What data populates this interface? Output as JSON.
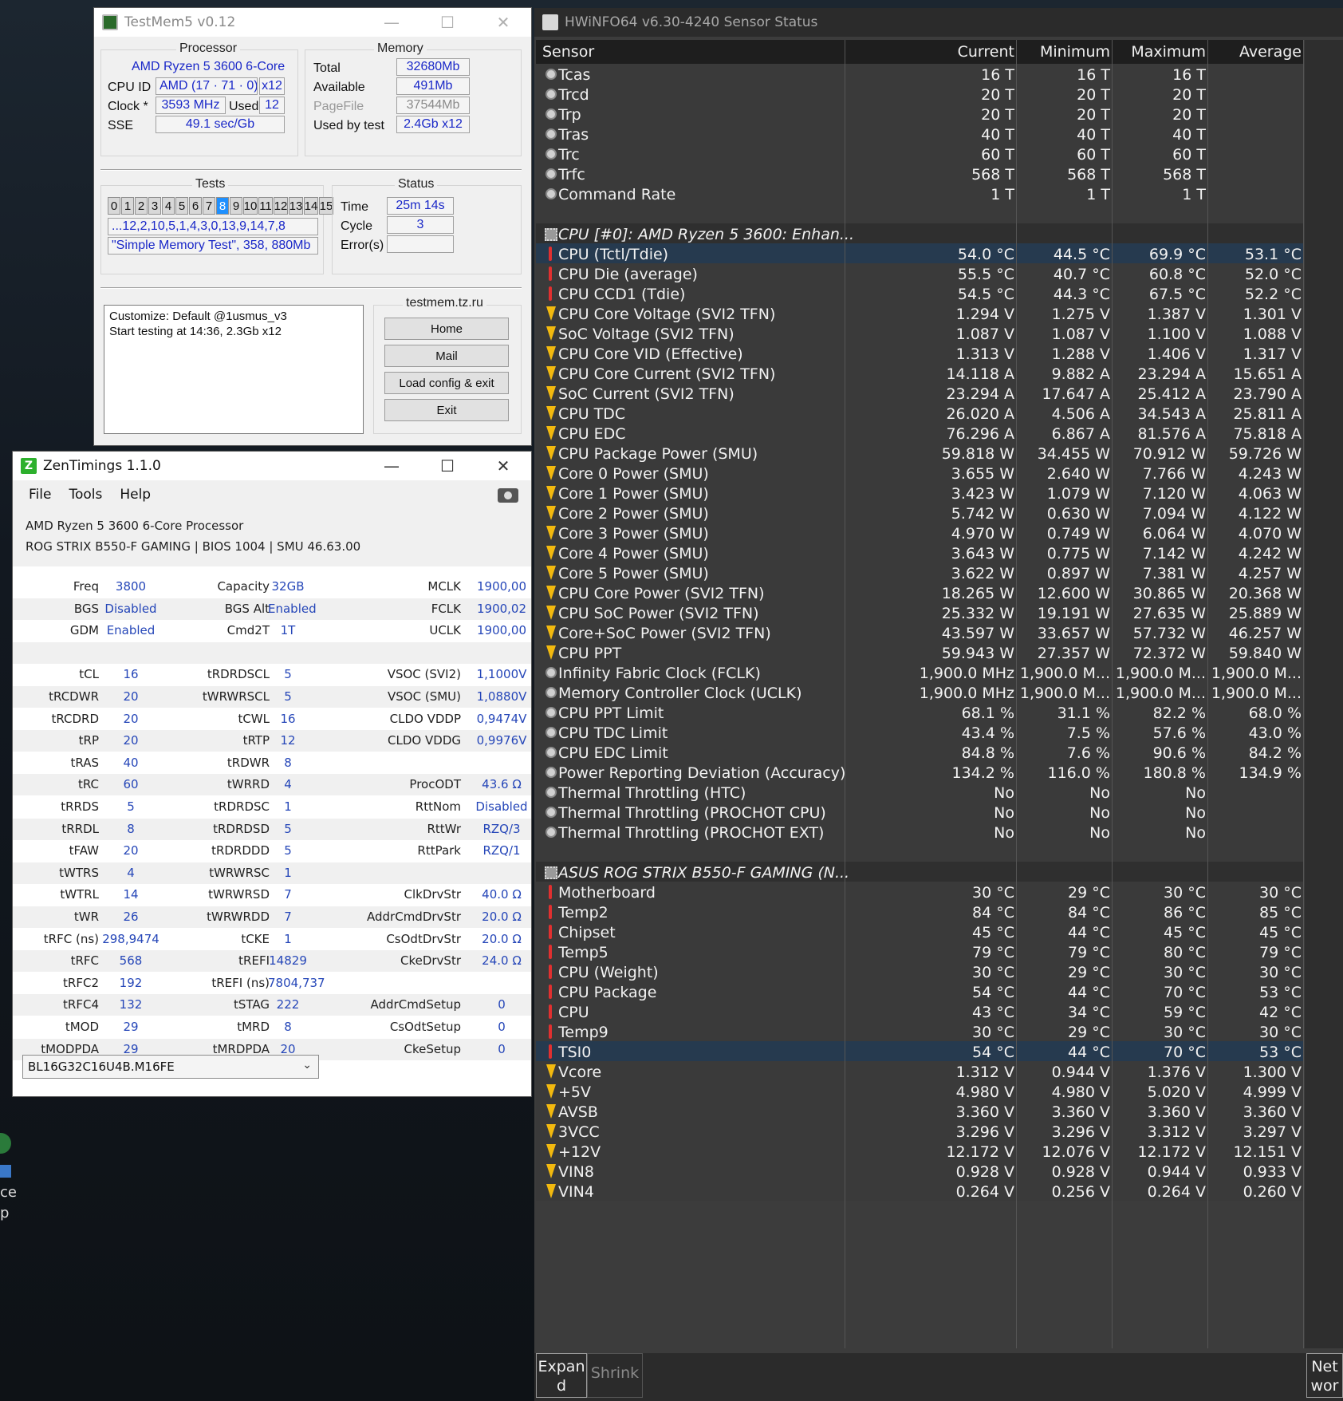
{
  "testmem": {
    "title": "TestMem5 v0.12",
    "processor_legend": "Processor",
    "cpu_name": "AMD Ryzen 5 3600 6-Core",
    "cpu_id_label": "CPU ID",
    "cpu_id_value": "AMD  (17 · 71 · 0)",
    "cpu_id_threads": "x12",
    "clock_label": "Clock *",
    "clock_value": "3593 MHz",
    "used_label": "Used",
    "used_value": "12",
    "sse_label": "SSE",
    "sse_value": "49.1 sec/Gb",
    "memory_legend": "Memory",
    "total_label": "Total",
    "total_value": "32680Mb",
    "available_label": "Available",
    "available_value": "491Mb",
    "pagefile_label": "PageFile",
    "pagefile_value": "37544Mb",
    "usedbytest_label": "Used by test",
    "usedbytest_value": "2.4Gb x12",
    "tests_legend": "Tests",
    "test_numbers": [
      "0",
      "1",
      "2",
      "3",
      "4",
      "5",
      "6",
      "7",
      "8",
      "9",
      "10",
      "11",
      "12",
      "13",
      "14",
      "15"
    ],
    "active_test": "8",
    "test_order": "...12,2,10,5,1,4,3,0,13,9,14,7,8",
    "test_desc": "\"Simple Memory Test\", 358, 880Mb",
    "status_legend": "Status",
    "time_label": "Time",
    "time_value": "25m 14s",
    "cycle_label": "Cycle",
    "cycle_value": "3",
    "errors_label": "Error(s)",
    "errors_value": "",
    "site_label": "testmem.tz.ru",
    "log_line1": "Customize: Default @1usmus_v3",
    "log_line2": "Start testing at 14:36, 2.3Gb x12",
    "btn_home": "Home",
    "btn_mail": "Mail",
    "btn_load": "Load config & exit",
    "btn_exit": "Exit"
  },
  "zen": {
    "title": "ZenTimings 1.1.0",
    "menu": [
      "File",
      "Tools",
      "Help"
    ],
    "cpu": "AMD Ryzen 5 3600 6-Core Processor",
    "board": "ROG STRIX B550-F GAMING | BIOS 1004 | SMU 46.63.00",
    "rows": [
      [
        [
          "Freq",
          "3800"
        ],
        [
          "Capacity",
          "32GB"
        ],
        [
          "MCLK",
          "1900,00"
        ]
      ],
      [
        [
          "BGS",
          "Disabled"
        ],
        [
          "BGS Alt",
          "Enabled"
        ],
        [
          "FCLK",
          "1900,02"
        ]
      ],
      [
        [
          "GDM",
          "Enabled"
        ],
        [
          "Cmd2T",
          "1T"
        ],
        [
          "UCLK",
          "1900,00"
        ]
      ],
      [
        [
          "",
          ""
        ],
        [
          "",
          ""
        ],
        [
          "",
          ""
        ]
      ],
      [
        [
          "tCL",
          "16"
        ],
        [
          "tRDRDSCL",
          "5"
        ],
        [
          "VSOC (SVI2)",
          "1,1000V"
        ]
      ],
      [
        [
          "tRCDWR",
          "20"
        ],
        [
          "tWRWRSCL",
          "5"
        ],
        [
          "VSOC (SMU)",
          "1,0880V"
        ]
      ],
      [
        [
          "tRCDRD",
          "20"
        ],
        [
          "tCWL",
          "16"
        ],
        [
          "CLDO VDDP",
          "0,9474V"
        ]
      ],
      [
        [
          "tRP",
          "20"
        ],
        [
          "tRTP",
          "12"
        ],
        [
          "CLDO VDDG",
          "0,9976V"
        ]
      ],
      [
        [
          "tRAS",
          "40"
        ],
        [
          "tRDWR",
          "8"
        ],
        [
          "",
          ""
        ]
      ],
      [
        [
          "tRC",
          "60"
        ],
        [
          "tWRRD",
          "4"
        ],
        [
          "ProcODT",
          "43.6 Ω"
        ]
      ],
      [
        [
          "tRRDS",
          "5"
        ],
        [
          "tRDRDSC",
          "1"
        ],
        [
          "RttNom",
          "Disabled"
        ]
      ],
      [
        [
          "tRRDL",
          "8"
        ],
        [
          "tRDRDSD",
          "5"
        ],
        [
          "RttWr",
          "RZQ/3"
        ]
      ],
      [
        [
          "tFAW",
          "20"
        ],
        [
          "tRDRDDD",
          "5"
        ],
        [
          "RttPark",
          "RZQ/1"
        ]
      ],
      [
        [
          "tWTRS",
          "4"
        ],
        [
          "tWRWRSC",
          "1"
        ],
        [
          "",
          ""
        ]
      ],
      [
        [
          "tWTRL",
          "14"
        ],
        [
          "tWRWRSD",
          "7"
        ],
        [
          "ClkDrvStr",
          "40.0 Ω"
        ]
      ],
      [
        [
          "tWR",
          "26"
        ],
        [
          "tWRWRDD",
          "7"
        ],
        [
          "AddrCmdDrvStr",
          "20.0 Ω"
        ]
      ],
      [
        [
          "tRFC (ns)",
          "298,9474"
        ],
        [
          "tCKE",
          "1"
        ],
        [
          "CsOdtDrvStr",
          "20.0 Ω"
        ]
      ],
      [
        [
          "tRFC",
          "568"
        ],
        [
          "tREFI",
          "14829"
        ],
        [
          "CkeDrvStr",
          "24.0 Ω"
        ]
      ],
      [
        [
          "tRFC2",
          "192"
        ],
        [
          "tREFI (ns)",
          "7804,737"
        ],
        [
          "",
          ""
        ]
      ],
      [
        [
          "tRFC4",
          "132"
        ],
        [
          "tSTAG",
          "222"
        ],
        [
          "AddrCmdSetup",
          "0"
        ]
      ],
      [
        [
          "tMOD",
          "29"
        ],
        [
          "tMRD",
          "8"
        ],
        [
          "CsOdtSetup",
          "0"
        ]
      ],
      [
        [
          "tMODPDA",
          "29"
        ],
        [
          "tMRDPDA",
          "20"
        ],
        [
          "CkeSetup",
          "0"
        ]
      ]
    ],
    "module": "BL16G32C16U4B.M16FE"
  },
  "hw": {
    "title": "HWiNFO64 v6.30-4240 Sensor Status",
    "headers": [
      "Sensor",
      "Current",
      "Minimum",
      "Maximum",
      "Average"
    ],
    "rows": [
      {
        "t": "clock",
        "n": "Tcas",
        "c": "16 T",
        "mi": "16 T",
        "ma": "16 T",
        "a": ""
      },
      {
        "t": "clock",
        "n": "Trcd",
        "c": "20 T",
        "mi": "20 T",
        "ma": "20 T",
        "a": ""
      },
      {
        "t": "clock",
        "n": "Trp",
        "c": "20 T",
        "mi": "20 T",
        "ma": "20 T",
        "a": ""
      },
      {
        "t": "clock",
        "n": "Tras",
        "c": "40 T",
        "mi": "40 T",
        "ma": "40 T",
        "a": ""
      },
      {
        "t": "clock",
        "n": "Trc",
        "c": "60 T",
        "mi": "60 T",
        "ma": "60 T",
        "a": ""
      },
      {
        "t": "clock",
        "n": "Trfc",
        "c": "568 T",
        "mi": "568 T",
        "ma": "568 T",
        "a": ""
      },
      {
        "t": "clock",
        "n": "Command Rate",
        "c": "1 T",
        "mi": "1 T",
        "ma": "1 T",
        "a": ""
      },
      {
        "t": "blank",
        "n": "",
        "c": "",
        "mi": "",
        "ma": "",
        "a": ""
      },
      {
        "t": "group",
        "n": "CPU [#0]: AMD Ryzen 5 3600: Enhan...",
        "c": "",
        "mi": "",
        "ma": "",
        "a": ""
      },
      {
        "t": "therm",
        "n": "CPU (Tctl/Tdie)",
        "c": "54.0 °C",
        "mi": "44.5 °C",
        "ma": "69.9 °C",
        "a": "53.1 °C",
        "sel": true
      },
      {
        "t": "therm",
        "n": "CPU Die (average)",
        "c": "55.5 °C",
        "mi": "40.7 °C",
        "ma": "60.8 °C",
        "a": "52.0 °C"
      },
      {
        "t": "therm",
        "n": "CPU CCD1 (Tdie)",
        "c": "54.5 °C",
        "mi": "44.3 °C",
        "ma": "67.5 °C",
        "a": "52.2 °C"
      },
      {
        "t": "bolt",
        "n": "CPU Core Voltage (SVI2 TFN)",
        "c": "1.294 V",
        "mi": "1.275 V",
        "ma": "1.387 V",
        "a": "1.301 V"
      },
      {
        "t": "bolt",
        "n": "SoC Voltage (SVI2 TFN)",
        "c": "1.087 V",
        "mi": "1.087 V",
        "ma": "1.100 V",
        "a": "1.088 V"
      },
      {
        "t": "bolt",
        "n": "CPU Core VID (Effective)",
        "c": "1.313 V",
        "mi": "1.288 V",
        "ma": "1.406 V",
        "a": "1.317 V"
      },
      {
        "t": "bolt",
        "n": "CPU Core Current (SVI2 TFN)",
        "c": "14.118 A",
        "mi": "9.882 A",
        "ma": "23.294 A",
        "a": "15.651 A"
      },
      {
        "t": "bolt",
        "n": "SoC Current (SVI2 TFN)",
        "c": "23.294 A",
        "mi": "17.647 A",
        "ma": "25.412 A",
        "a": "23.790 A"
      },
      {
        "t": "bolt",
        "n": "CPU TDC",
        "c": "26.020 A",
        "mi": "4.506 A",
        "ma": "34.543 A",
        "a": "25.811 A"
      },
      {
        "t": "bolt",
        "n": "CPU EDC",
        "c": "76.296 A",
        "mi": "6.867 A",
        "ma": "81.576 A",
        "a": "75.818 A"
      },
      {
        "t": "bolt",
        "n": "CPU Package Power (SMU)",
        "c": "59.818 W",
        "mi": "34.455 W",
        "ma": "70.912 W",
        "a": "59.726 W"
      },
      {
        "t": "bolt",
        "n": "Core 0 Power (SMU)",
        "c": "3.655 W",
        "mi": "2.640 W",
        "ma": "7.766 W",
        "a": "4.243 W"
      },
      {
        "t": "bolt",
        "n": "Core 1 Power (SMU)",
        "c": "3.423 W",
        "mi": "1.079 W",
        "ma": "7.120 W",
        "a": "4.063 W"
      },
      {
        "t": "bolt",
        "n": "Core 2 Power (SMU)",
        "c": "5.742 W",
        "mi": "0.630 W",
        "ma": "7.094 W",
        "a": "4.122 W"
      },
      {
        "t": "bolt",
        "n": "Core 3 Power (SMU)",
        "c": "4.970 W",
        "mi": "0.749 W",
        "ma": "6.064 W",
        "a": "4.070 W"
      },
      {
        "t": "bolt",
        "n": "Core 4 Power (SMU)",
        "c": "3.643 W",
        "mi": "0.775 W",
        "ma": "7.142 W",
        "a": "4.242 W"
      },
      {
        "t": "bolt",
        "n": "Core 5 Power (SMU)",
        "c": "3.622 W",
        "mi": "0.897 W",
        "ma": "7.381 W",
        "a": "4.257 W"
      },
      {
        "t": "bolt",
        "n": "CPU Core Power (SVI2 TFN)",
        "c": "18.265 W",
        "mi": "12.600 W",
        "ma": "30.865 W",
        "a": "20.368 W"
      },
      {
        "t": "bolt",
        "n": "CPU SoC Power (SVI2 TFN)",
        "c": "25.332 W",
        "mi": "19.191 W",
        "ma": "27.635 W",
        "a": "25.889 W"
      },
      {
        "t": "bolt",
        "n": "Core+SoC Power (SVI2 TFN)",
        "c": "43.597 W",
        "mi": "33.657 W",
        "ma": "57.732 W",
        "a": "46.257 W"
      },
      {
        "t": "bolt",
        "n": "CPU PPT",
        "c": "59.943 W",
        "mi": "27.357 W",
        "ma": "72.372 W",
        "a": "59.840 W"
      },
      {
        "t": "clock",
        "n": "Infinity Fabric Clock (FCLK)",
        "c": "1,900.0 MHz",
        "mi": "1,900.0 M...",
        "ma": "1,900.0 M...",
        "a": "1,900.0 M..."
      },
      {
        "t": "clock",
        "n": "Memory Controller Clock (UCLK)",
        "c": "1,900.0 MHz",
        "mi": "1,900.0 M...",
        "ma": "1,900.0 M...",
        "a": "1,900.0 M..."
      },
      {
        "t": "clock",
        "n": "CPU PPT Limit",
        "c": "68.1 %",
        "mi": "31.1 %",
        "ma": "82.2 %",
        "a": "68.0 %"
      },
      {
        "t": "clock",
        "n": "CPU TDC Limit",
        "c": "43.4 %",
        "mi": "7.5 %",
        "ma": "57.6 %",
        "a": "43.0 %"
      },
      {
        "t": "clock",
        "n": "CPU EDC Limit",
        "c": "84.8 %",
        "mi": "7.6 %",
        "ma": "90.6 %",
        "a": "84.2 %"
      },
      {
        "t": "clock",
        "n": "Power Reporting Deviation (Accuracy)",
        "c": "134.2 %",
        "mi": "116.0 %",
        "ma": "180.8 %",
        "a": "134.9 %"
      },
      {
        "t": "clock",
        "n": "Thermal Throttling (HTC)",
        "c": "No",
        "mi": "No",
        "ma": "No",
        "a": ""
      },
      {
        "t": "clock",
        "n": "Thermal Throttling (PROCHOT CPU)",
        "c": "No",
        "mi": "No",
        "ma": "No",
        "a": ""
      },
      {
        "t": "clock",
        "n": "Thermal Throttling (PROCHOT EXT)",
        "c": "No",
        "mi": "No",
        "ma": "No",
        "a": ""
      },
      {
        "t": "blank",
        "n": "",
        "c": "",
        "mi": "",
        "ma": "",
        "a": ""
      },
      {
        "t": "group",
        "n": "ASUS ROG STRIX B550-F GAMING (N...",
        "c": "",
        "mi": "",
        "ma": "",
        "a": ""
      },
      {
        "t": "therm",
        "n": "Motherboard",
        "c": "30 °C",
        "mi": "29 °C",
        "ma": "30 °C",
        "a": "30 °C"
      },
      {
        "t": "therm",
        "n": "Temp2",
        "c": "84 °C",
        "mi": "84 °C",
        "ma": "86 °C",
        "a": "85 °C"
      },
      {
        "t": "therm",
        "n": "Chipset",
        "c": "45 °C",
        "mi": "44 °C",
        "ma": "45 °C",
        "a": "45 °C"
      },
      {
        "t": "therm",
        "n": "Temp5",
        "c": "79 °C",
        "mi": "79 °C",
        "ma": "80 °C",
        "a": "79 °C"
      },
      {
        "t": "therm",
        "n": "CPU (Weight)",
        "c": "30 °C",
        "mi": "29 °C",
        "ma": "30 °C",
        "a": "30 °C"
      },
      {
        "t": "therm",
        "n": "CPU Package",
        "c": "54 °C",
        "mi": "44 °C",
        "ma": "70 °C",
        "a": "53 °C"
      },
      {
        "t": "therm",
        "n": "CPU",
        "c": "43 °C",
        "mi": "34 °C",
        "ma": "59 °C",
        "a": "42 °C"
      },
      {
        "t": "therm",
        "n": "Temp9",
        "c": "30 °C",
        "mi": "29 °C",
        "ma": "30 °C",
        "a": "30 °C"
      },
      {
        "t": "therm",
        "n": "TSI0",
        "c": "54 °C",
        "mi": "44 °C",
        "ma": "70 °C",
        "a": "53 °C",
        "sel": true
      },
      {
        "t": "bolt",
        "n": "Vcore",
        "c": "1.312 V",
        "mi": "0.944 V",
        "ma": "1.376 V",
        "a": "1.300 V"
      },
      {
        "t": "bolt",
        "n": "+5V",
        "c": "4.980 V",
        "mi": "4.980 V",
        "ma": "5.020 V",
        "a": "4.999 V"
      },
      {
        "t": "bolt",
        "n": "AVSB",
        "c": "3.360 V",
        "mi": "3.360 V",
        "ma": "3.360 V",
        "a": "3.360 V"
      },
      {
        "t": "bolt",
        "n": "3VCC",
        "c": "3.296 V",
        "mi": "3.296 V",
        "ma": "3.312 V",
        "a": "3.297 V"
      },
      {
        "t": "bolt",
        "n": "+12V",
        "c": "12.172 V",
        "mi": "12.076 V",
        "ma": "12.172 V",
        "a": "12.151 V"
      },
      {
        "t": "bolt",
        "n": "VIN8",
        "c": "0.928 V",
        "mi": "0.928 V",
        "ma": "0.944 V",
        "a": "0.933 V"
      },
      {
        "t": "bolt",
        "n": "VIN4",
        "c": "0.264 V",
        "mi": "0.256 V",
        "ma": "0.264 V",
        "a": "0.260 V"
      }
    ],
    "btn_expand": "Expan\nd",
    "btn_shrink": "Shrink",
    "btn_net": "Net\nwor"
  }
}
